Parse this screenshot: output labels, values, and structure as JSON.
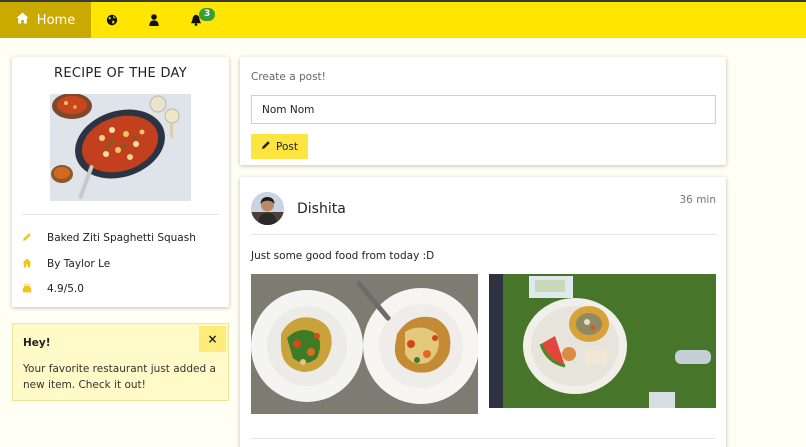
{
  "nav": {
    "home_label": "Home",
    "items": [
      {
        "icon": "globe-icon"
      },
      {
        "icon": "user-icon"
      },
      {
        "icon": "bell-icon",
        "badge": "3"
      }
    ],
    "colors": {
      "bar": "#ffe501",
      "active": "#c9ab00",
      "badge": "#3a9b3a"
    }
  },
  "recipe": {
    "title": "RECIPE OF THE DAY",
    "image": "baked-ziti-photo",
    "rows": [
      {
        "icon": "pencil-icon",
        "text": "Baked Ziti Spaghetti Squash"
      },
      {
        "icon": "home-icon",
        "text": "By Taylor Le"
      },
      {
        "icon": "cake-icon",
        "text": "4.9/5.0"
      }
    ]
  },
  "alert": {
    "title": "Hey!",
    "close": "×",
    "message": "Your favorite restaurant just added a new item. Check it out!"
  },
  "create_post": {
    "label": "Create a post!",
    "input_value": "Nom Nom",
    "button_label": "Post"
  },
  "post": {
    "author": "Dishita",
    "time": "36 min",
    "text": "Just some good food from today :D",
    "images": [
      "pasta-plates-photo",
      "picnic-plate-photo"
    ]
  }
}
